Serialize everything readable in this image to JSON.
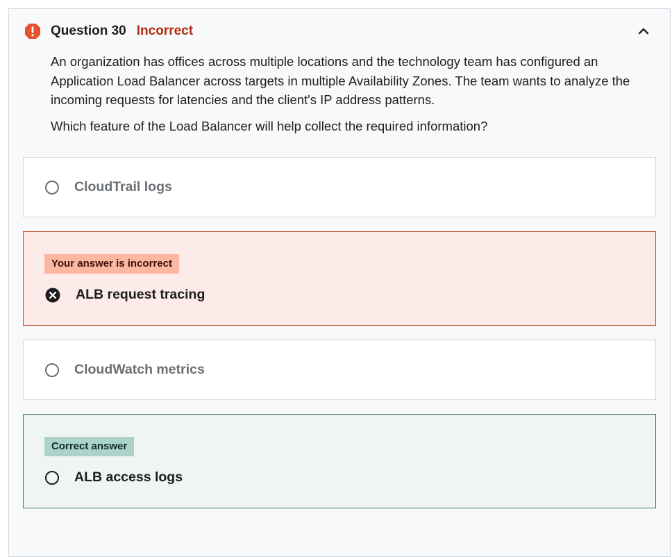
{
  "question": {
    "number_label": "Question 30",
    "status": "Incorrect",
    "paragraphs": [
      "An organization has offices across multiple locations and the technology team has configured an Application Load Balancer across targets in multiple Availability Zones. The team wants to analyze the incoming requests for latencies and the client's IP address patterns.",
      "Which feature of the Load Balancer will help collect the required information?"
    ]
  },
  "options": [
    {
      "label": "CloudTrail logs",
      "state": "unselected"
    },
    {
      "label": "ALB request tracing",
      "state": "selected_incorrect",
      "tag": "Your answer is incorrect"
    },
    {
      "label": "CloudWatch metrics",
      "state": "unselected"
    },
    {
      "label": "ALB access logs",
      "state": "correct",
      "tag": "Correct answer"
    }
  ],
  "icons": {
    "status": "warning-octagon-icon",
    "collapse": "chevron-up-icon",
    "wrong": "x-circle-icon",
    "radio": "radio-circle-icon"
  },
  "colors": {
    "incorrect_text": "#b32d0f",
    "warning_icon": "#e8522e",
    "incorrect_bg": "#fcebe8",
    "incorrect_border": "#c24e33",
    "incorrect_tag": "#fbb79f",
    "correct_bg": "#eef5f3",
    "correct_border": "#3c7668",
    "correct_tag": "#acd2cc"
  }
}
